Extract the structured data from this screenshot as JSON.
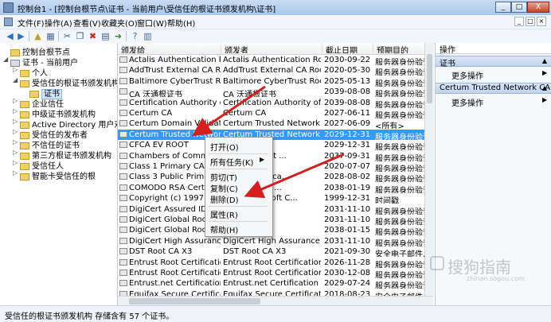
{
  "window": {
    "title": "控制台1 - [控制台根节点\\证书 - 当前用户\\受信任的根证书颁发机构\\证书]",
    "buttons": [
      "_",
      "□",
      "X"
    ],
    "mdi_buttons": [
      "_",
      "□",
      "×"
    ]
  },
  "menu": [
    "文件(F)",
    "操作(A)",
    "查看(V)",
    "收藏夹(O)",
    "窗口(W)",
    "帮助(H)"
  ],
  "toolbar": [
    {
      "icon": "back-arrow-icon",
      "glyph": "◀",
      "color": "#2f6fc4"
    },
    {
      "icon": "forward-arrow-icon",
      "glyph": "▶",
      "color": "#2f6fc4"
    },
    {
      "icon": "up-folder-icon",
      "glyph": "▲",
      "color": "#c59b2b"
    },
    {
      "icon": "show-hide-tree-icon",
      "glyph": "▦",
      "color": "#4a6a94"
    },
    {
      "icon": "cut-icon",
      "glyph": "✂",
      "color": "#3a5a84"
    },
    {
      "icon": "copy-icon",
      "glyph": "❐",
      "color": "#3a5a84"
    },
    {
      "icon": "delete-icon",
      "glyph": "✖",
      "color": "#c8281e"
    },
    {
      "icon": "properties-icon",
      "glyph": "▤",
      "color": "#3a5a84"
    },
    {
      "icon": "export-icon",
      "glyph": "➜",
      "color": "#3a8a3a"
    },
    {
      "icon": "help-icon",
      "glyph": "?",
      "color": "#2f6fc4"
    },
    {
      "icon": "show-hide-action-pane-icon",
      "glyph": "▥",
      "color": "#4a6a94"
    }
  ],
  "tree": [
    {
      "label": "控制台根节点",
      "level": 0,
      "exp": "",
      "icon": "folder",
      "name": "tree-console-root"
    },
    {
      "label": "证书 - 当前用户",
      "level": 0,
      "exp": "◢",
      "icon": "cert",
      "name": "tree-certs-current-user"
    },
    {
      "label": "个人",
      "level": 1,
      "exp": "▷",
      "icon": "folder",
      "name": "tree-personal"
    },
    {
      "label": "受信任的根证书颁发机构",
      "level": 1,
      "exp": "◢",
      "icon": "folder",
      "name": "tree-trusted-root-ca"
    },
    {
      "label": "证书",
      "level": 2,
      "exp": "",
      "icon": "folder",
      "name": "tree-certificates",
      "selected": true
    },
    {
      "label": "企业信任",
      "level": 1,
      "exp": "▷",
      "icon": "folder",
      "name": "tree-enterprise-trust"
    },
    {
      "label": "中级证书颁发机构",
      "level": 1,
      "exp": "▷",
      "icon": "folder",
      "name": "tree-intermediate-ca"
    },
    {
      "label": "Active Directory 用户对象",
      "level": 1,
      "exp": "▷",
      "icon": "folder",
      "name": "tree-ad-user-object"
    },
    {
      "label": "受信任的发布者",
      "level": 1,
      "exp": "▷",
      "icon": "folder",
      "name": "tree-trusted-publishers"
    },
    {
      "label": "不信任的证书",
      "level": 1,
      "exp": "▷",
      "icon": "folder",
      "name": "tree-untrusted-certs"
    },
    {
      "label": "第三方根证书颁发机构",
      "level": 1,
      "exp": "▷",
      "icon": "folder",
      "name": "tree-third-party-root-ca"
    },
    {
      "label": "受信任人",
      "level": 1,
      "exp": "▷",
      "icon": "folder",
      "name": "tree-trusted-people"
    },
    {
      "label": "智能卡受信任的根",
      "level": 1,
      "exp": "▷",
      "icon": "folder",
      "name": "tree-smart-card-roots"
    }
  ],
  "list": {
    "columns": [
      "颁发给",
      "颁发者",
      "截止日期",
      "预期目的"
    ],
    "rows": [
      {
        "to": "Actalis Authentication Root CA",
        "by": "Actalis Authentication Root CA",
        "date": "2030-09-22",
        "purpose": "服务器身份验证, 客"
      },
      {
        "to": "AddTrust External CA Root",
        "by": "AddTrust External CA Root",
        "date": "2020-05-30",
        "purpose": "服务器身份验证, 客"
      },
      {
        "to": "Baltimore CyberTrust Root",
        "by": "Baltimore CyberTrust Root",
        "date": "2025-05-13",
        "purpose": "服务器身份验证, 客"
      },
      {
        "to": "CA 沃通根证书",
        "by": "CA 沃通根证书",
        "date": "2039-08-08",
        "purpose": "服务器身份验证, 客"
      },
      {
        "to": "Certification Authority of Wo...",
        "by": "Certification Authority of WoSi...",
        "date": "2039-08-08",
        "purpose": "服务器身份验证, 客"
      },
      {
        "to": "Certum CA",
        "by": "Certum CA",
        "date": "2027-06-11",
        "purpose": "服务器身份验证, 客"
      },
      {
        "to": "Certum Domain Validation C...",
        "by": "Certum Trusted Network CA",
        "date": "2027-06-09",
        "purpose": "<所有>"
      },
      {
        "to": "Certum Trusted Network CA",
        "by": "Certum Trusted Network CA",
        "date": "2029-12-31",
        "purpose": "服务器身份验证, 客",
        "selected": true
      },
      {
        "to": "CFCA EV ROOT",
        "by": "",
        "date": "2029-12-31",
        "purpose": "服务器身份验证, 客"
      },
      {
        "to": "Chambers of Comme",
        "by": "mmerce Root ...",
        "date": "2037-09-31",
        "purpose": "服务器身份验证, 客"
      },
      {
        "to": "Class 1 Primary CA",
        "by": "",
        "date": "2020-07-07",
        "purpose": "服务器身份验证, 客"
      },
      {
        "to": "Class 3 Public Prima",
        "by": "imary Certifica...",
        "date": "2028-08-02",
        "purpose": "服务器身份验证, 客"
      },
      {
        "to": "COMODO RSA Certifi",
        "by": "Certification ...",
        "date": "2038-01-19",
        "purpose": "服务器身份验证, 客"
      },
      {
        "to": "Copyright (c) 1997 Mi",
        "by": "1997 Microsoft C...",
        "date": "1999-12-31",
        "purpose": "时间戳"
      },
      {
        "to": "DigiCert Assured ID R",
        "by": "d ID Root CA",
        "date": "2031-11-10",
        "purpose": "服务器身份验证, 客"
      },
      {
        "to": "DigiCert Global Root",
        "by": "ot CA",
        "date": "2031-11-10",
        "purpose": "服务器身份验证, 客"
      },
      {
        "to": "DigiCert Global Root",
        "by": "ot G2",
        "date": "2038-01-15",
        "purpose": "服务器身份验证, 客"
      },
      {
        "to": "DigiCert High Assurance EV ...",
        "by": "DigiCert High Assurance EV R...",
        "date": "2031-11-10",
        "purpose": "服务器身份验证, 客"
      },
      {
        "to": "DST Root CA X3",
        "by": "DST Root CA X3",
        "date": "2021-09-30",
        "purpose": "安全电子邮件, 服务"
      },
      {
        "to": "Entrust Root Certification Au...",
        "by": "Entrust Root Certification Au...",
        "date": "2026-11-28",
        "purpose": "服务器身份验证, 客"
      },
      {
        "to": "Entrust Root Certification Au...",
        "by": "Entrust Root Certification Au...",
        "date": "2030-12-08",
        "purpose": "服务器身份验证, 客"
      },
      {
        "to": "Entrust.net Certification Auth...",
        "by": "Entrust.net Certification Auth...",
        "date": "2029-07-24",
        "purpose": "服务器身份验证, 客"
      },
      {
        "to": "Equifax Secure Certificate Au...",
        "by": "Equifax Secure Certificate Au...",
        "date": "2018-08-23",
        "purpose": "安全电子邮件, 服务"
      }
    ]
  },
  "context_menu": {
    "items": [
      "打开(O)",
      "所有任务(K)",
      "剪切(T)",
      "复制(C)",
      "删除(D)",
      "属性(R)",
      "帮助(H)"
    ]
  },
  "actions": {
    "header": "操作",
    "group1_title": "证书",
    "group1_more": "更多操作",
    "group2_title": "Certum Trusted Network CA",
    "group2_more": "更多操作"
  },
  "status": "受信任的根证书颁发机构 存储含有 57 个证书。",
  "watermark": {
    "text": "搜狗指南",
    "url": "zhinan.sogou.com"
  },
  "colors": {
    "selection": "#3399ff",
    "annotation_arrow": "#d41f1f"
  }
}
